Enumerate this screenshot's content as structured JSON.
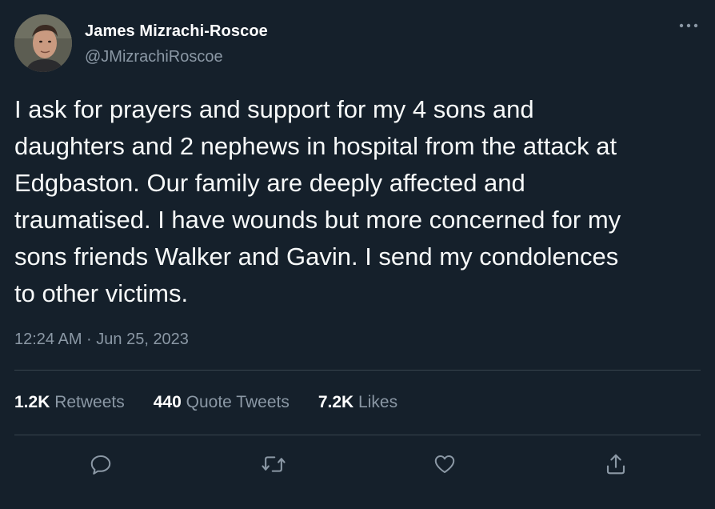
{
  "author": {
    "display_name": "James Mizrachi-Roscoe",
    "handle": "@JMizrachiRoscoe",
    "avatar_icon": "profile-photo"
  },
  "tweet": {
    "text": "I ask for prayers and support for my 4 sons and\ndaughters and 2 nephews in hospital from the attack at\nEdgbaston. Our family are deeply affected and\ntraumatised. I have wounds but more concerned for my\nsons friends Walker and Gavin. I send my condolences\nto other victims.",
    "timestamp": "12:24 AM · Jun 25, 2023"
  },
  "stats": {
    "retweets_count": "1.2K",
    "retweets_label": "Retweets",
    "quote_count": "440",
    "quote_label": "Quote Tweets",
    "likes_count": "7.2K",
    "likes_label": "Likes"
  },
  "actions": {
    "reply_icon": "reply-icon",
    "retweet_icon": "retweet-icon",
    "like_icon": "heart-icon",
    "share_icon": "share-icon"
  },
  "colors": {
    "background": "#15202b",
    "primary_text": "#ffffff",
    "secondary_text": "#8b98a5",
    "divider": "#38444d"
  }
}
